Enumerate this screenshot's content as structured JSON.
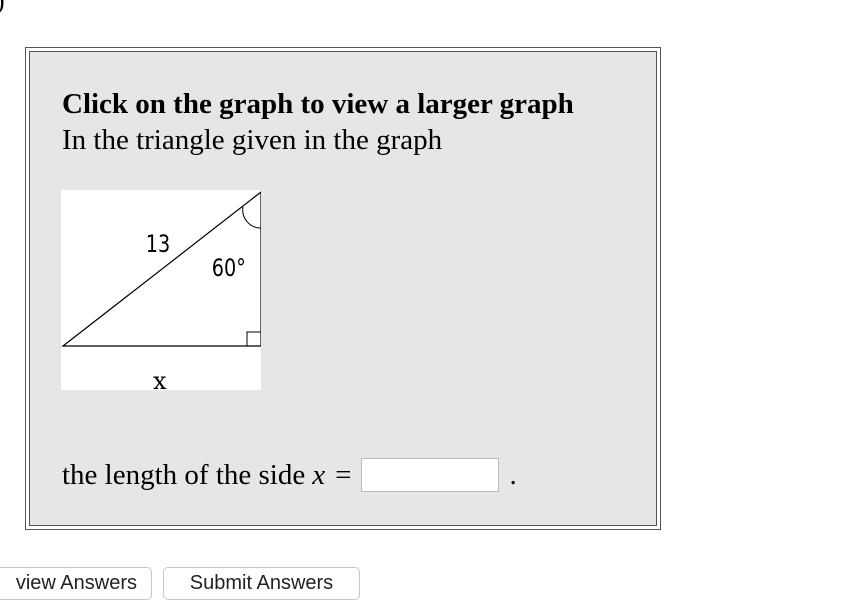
{
  "header_fragment": ")",
  "problem": {
    "instruction": "Click on the graph to view a larger graph",
    "prompt": "In the triangle given in the graph",
    "answer_prefix": "the length of the side",
    "answer_variable": "x",
    "answer_equals": "=",
    "answer_value": "",
    "answer_suffix": "."
  },
  "graph": {
    "hypotenuse_label": "13",
    "angle_label": "60°",
    "base_label": "x"
  },
  "buttons": {
    "preview": "view Answers",
    "submit": "Submit Answers"
  }
}
